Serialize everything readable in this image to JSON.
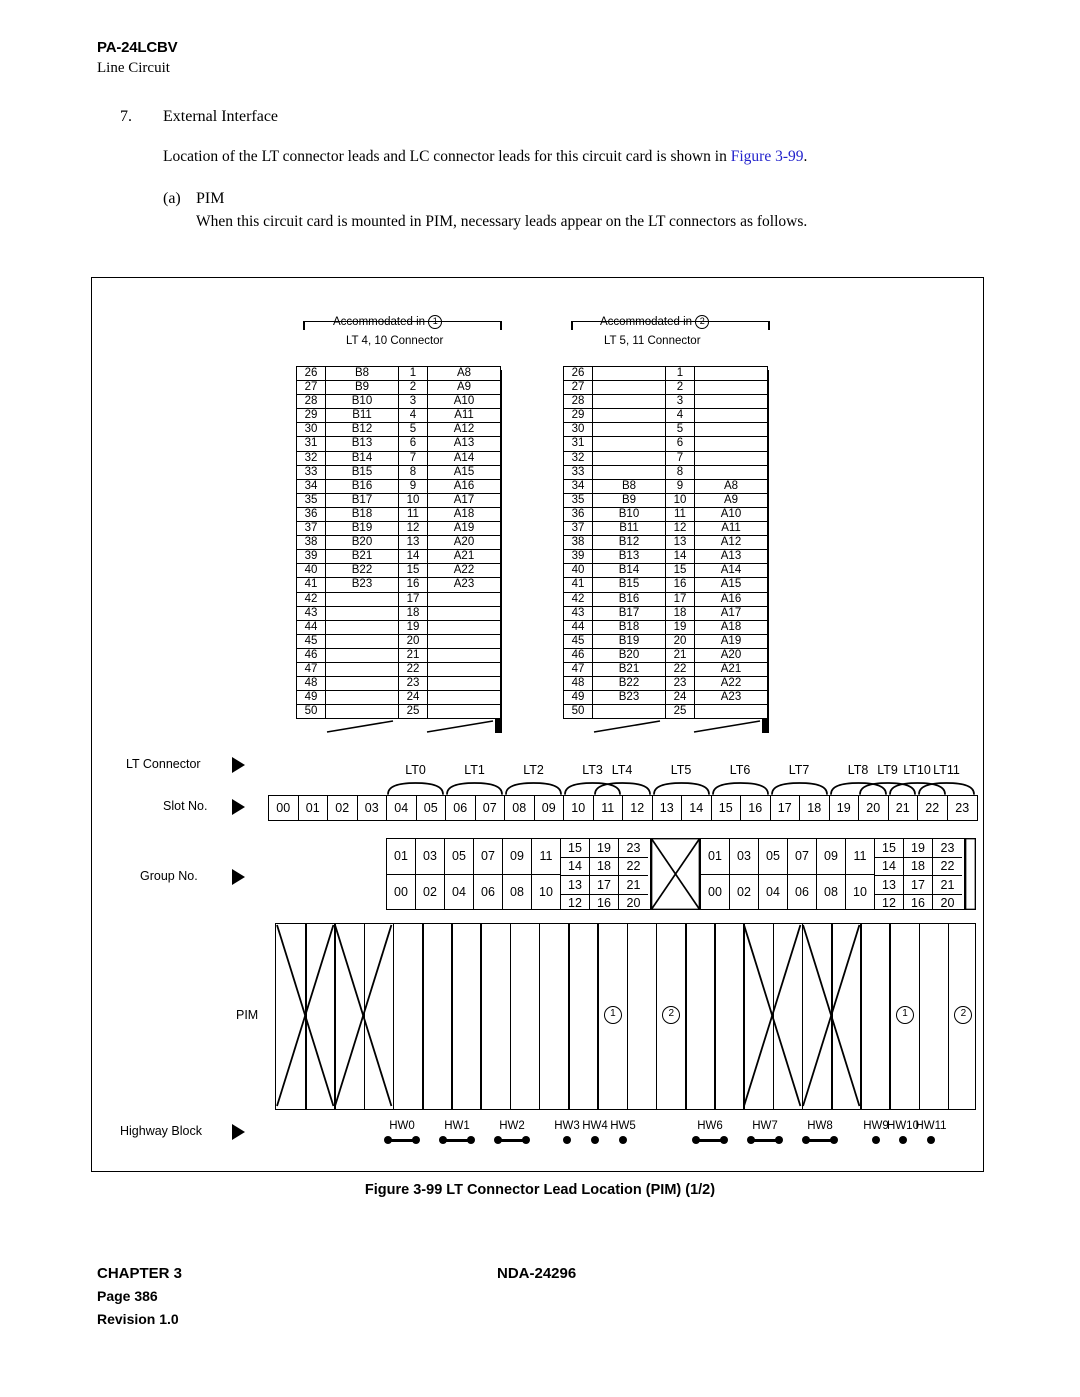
{
  "header": {
    "product": "PA-24LCBV",
    "subtitle": "Line Circuit"
  },
  "section": {
    "number": "7.",
    "title": "External Interface",
    "paragraph": "Location of the LT connector leads and LC connector leads for this circuit card is shown in",
    "link": "Figure 3-99",
    "paragraph_end": ".",
    "sub_label": "(a)",
    "sub_title": "PIM",
    "sub_paragraph": "When this circuit card is mounted in PIM, necessary leads appear on the LT connectors as follows."
  },
  "figure": {
    "caption": "Figure 3-99   LT Connector Lead Location (PIM) (1/2)",
    "connectors": [
      {
        "accommodated_label": "Accommodated in",
        "accommodated_marker": "1",
        "connector_label": "LT 4, 10 Connector",
        "rows": [
          {
            "left_no": "26",
            "left_val": "B8",
            "right_no": "1",
            "right_val": "A8"
          },
          {
            "left_no": "27",
            "left_val": "B9",
            "right_no": "2",
            "right_val": "A9"
          },
          {
            "left_no": "28",
            "left_val": "B10",
            "right_no": "3",
            "right_val": "A10"
          },
          {
            "left_no": "29",
            "left_val": "B11",
            "right_no": "4",
            "right_val": "A11"
          },
          {
            "left_no": "30",
            "left_val": "B12",
            "right_no": "5",
            "right_val": "A12"
          },
          {
            "left_no": "31",
            "left_val": "B13",
            "right_no": "6",
            "right_val": "A13"
          },
          {
            "left_no": "32",
            "left_val": "B14",
            "right_no": "7",
            "right_val": "A14"
          },
          {
            "left_no": "33",
            "left_val": "B15",
            "right_no": "8",
            "right_val": "A15"
          },
          {
            "left_no": "34",
            "left_val": "B16",
            "right_no": "9",
            "right_val": "A16"
          },
          {
            "left_no": "35",
            "left_val": "B17",
            "right_no": "10",
            "right_val": "A17"
          },
          {
            "left_no": "36",
            "left_val": "B18",
            "right_no": "11",
            "right_val": "A18"
          },
          {
            "left_no": "37",
            "left_val": "B19",
            "right_no": "12",
            "right_val": "A19"
          },
          {
            "left_no": "38",
            "left_val": "B20",
            "right_no": "13",
            "right_val": "A20"
          },
          {
            "left_no": "39",
            "left_val": "B21",
            "right_no": "14",
            "right_val": "A21"
          },
          {
            "left_no": "40",
            "left_val": "B22",
            "right_no": "15",
            "right_val": "A22"
          },
          {
            "left_no": "41",
            "left_val": "B23",
            "right_no": "16",
            "right_val": "A23"
          },
          {
            "left_no": "42",
            "left_val": "",
            "right_no": "17",
            "right_val": ""
          },
          {
            "left_no": "43",
            "left_val": "",
            "right_no": "18",
            "right_val": ""
          },
          {
            "left_no": "44",
            "left_val": "",
            "right_no": "19",
            "right_val": ""
          },
          {
            "left_no": "45",
            "left_val": "",
            "right_no": "20",
            "right_val": ""
          },
          {
            "left_no": "46",
            "left_val": "",
            "right_no": "21",
            "right_val": ""
          },
          {
            "left_no": "47",
            "left_val": "",
            "right_no": "22",
            "right_val": ""
          },
          {
            "left_no": "48",
            "left_val": "",
            "right_no": "23",
            "right_val": ""
          },
          {
            "left_no": "49",
            "left_val": "",
            "right_no": "24",
            "right_val": ""
          },
          {
            "left_no": "50",
            "left_val": "",
            "right_no": "25",
            "right_val": ""
          }
        ]
      },
      {
        "accommodated_label": "Accommodated in",
        "accommodated_marker": "2",
        "connector_label": "LT 5, 11 Connector",
        "rows": [
          {
            "left_no": "26",
            "left_val": "",
            "right_no": "1",
            "right_val": ""
          },
          {
            "left_no": "27",
            "left_val": "",
            "right_no": "2",
            "right_val": ""
          },
          {
            "left_no": "28",
            "left_val": "",
            "right_no": "3",
            "right_val": ""
          },
          {
            "left_no": "29",
            "left_val": "",
            "right_no": "4",
            "right_val": ""
          },
          {
            "left_no": "30",
            "left_val": "",
            "right_no": "5",
            "right_val": ""
          },
          {
            "left_no": "31",
            "left_val": "",
            "right_no": "6",
            "right_val": ""
          },
          {
            "left_no": "32",
            "left_val": "",
            "right_no": "7",
            "right_val": ""
          },
          {
            "left_no": "33",
            "left_val": "",
            "right_no": "8",
            "right_val": ""
          },
          {
            "left_no": "34",
            "left_val": "B8",
            "right_no": "9",
            "right_val": "A8"
          },
          {
            "left_no": "35",
            "left_val": "B9",
            "right_no": "10",
            "right_val": "A9"
          },
          {
            "left_no": "36",
            "left_val": "B10",
            "right_no": "11",
            "right_val": "A10"
          },
          {
            "left_no": "37",
            "left_val": "B11",
            "right_no": "12",
            "right_val": "A11"
          },
          {
            "left_no": "38",
            "left_val": "B12",
            "right_no": "13",
            "right_val": "A12"
          },
          {
            "left_no": "39",
            "left_val": "B13",
            "right_no": "14",
            "right_val": "A13"
          },
          {
            "left_no": "40",
            "left_val": "B14",
            "right_no": "15",
            "right_val": "A14"
          },
          {
            "left_no": "41",
            "left_val": "B15",
            "right_no": "16",
            "right_val": "A15"
          },
          {
            "left_no": "42",
            "left_val": "B16",
            "right_no": "17",
            "right_val": "A16"
          },
          {
            "left_no": "43",
            "left_val": "B17",
            "right_no": "18",
            "right_val": "A17"
          },
          {
            "left_no": "44",
            "left_val": "B18",
            "right_no": "19",
            "right_val": "A18"
          },
          {
            "left_no": "45",
            "left_val": "B19",
            "right_no": "20",
            "right_val": "A19"
          },
          {
            "left_no": "46",
            "left_val": "B20",
            "right_no": "21",
            "right_val": "A20"
          },
          {
            "left_no": "47",
            "left_val": "B21",
            "right_no": "22",
            "right_val": "A21"
          },
          {
            "left_no": "48",
            "left_val": "B22",
            "right_no": "23",
            "right_val": "A22"
          },
          {
            "left_no": "49",
            "left_val": "B23",
            "right_no": "24",
            "right_val": "A23"
          },
          {
            "left_no": "50",
            "left_val": "",
            "right_no": "25",
            "right_val": ""
          }
        ]
      }
    ],
    "row_labels": {
      "lt_connector": "LT Connector",
      "slot_no": "Slot No.",
      "group_no": "Group No.",
      "pim": "PIM",
      "highway_block": "Highway Block"
    },
    "lt_labels": [
      "LT0",
      "LT1",
      "LT2",
      "LT3",
      "LT4",
      "LT5",
      "LT6",
      "LT7",
      "LT8",
      "LT9",
      "LT10",
      "LT11"
    ],
    "slot_numbers": [
      "00",
      "01",
      "02",
      "03",
      "04",
      "05",
      "06",
      "07",
      "08",
      "09",
      "10",
      "11",
      "12",
      "13",
      "14",
      "15",
      "16",
      "17",
      "18",
      "19",
      "20",
      "21",
      "22",
      "23"
    ],
    "group_left": {
      "pairs": [
        {
          "top": "01",
          "bottom": "00"
        },
        {
          "top": "03",
          "bottom": "02"
        },
        {
          "top": "05",
          "bottom": "04"
        },
        {
          "top": "07",
          "bottom": "06"
        },
        {
          "top": "09",
          "bottom": "08"
        },
        {
          "top": "11",
          "bottom": "10"
        }
      ],
      "quads": [
        {
          "r1": "15",
          "r2": "14",
          "r3": "13",
          "r4": "12"
        },
        {
          "r1": "19",
          "r2": "18",
          "r3": "17",
          "r4": "16"
        },
        {
          "r1": "23",
          "r2": "22",
          "r3": "21",
          "r4": "20"
        }
      ]
    },
    "group_right": {
      "pairs": [
        {
          "top": "01",
          "bottom": "00"
        },
        {
          "top": "03",
          "bottom": "02"
        },
        {
          "top": "05",
          "bottom": "04"
        },
        {
          "top": "07",
          "bottom": "06"
        },
        {
          "top": "09",
          "bottom": "08"
        },
        {
          "top": "11",
          "bottom": "10"
        }
      ],
      "quads": [
        {
          "r1": "15",
          "r2": "14",
          "r3": "13",
          "r4": "12"
        },
        {
          "r1": "19",
          "r2": "18",
          "r3": "17",
          "r4": "16"
        },
        {
          "r1": "23",
          "r2": "22",
          "r3": "21",
          "r4": "20"
        }
      ]
    },
    "pim_markers": [
      {
        "marker": "1"
      },
      {
        "marker": "2"
      },
      {
        "marker": "1"
      },
      {
        "marker": "2"
      }
    ],
    "highway_blocks": [
      {
        "label": "HW0",
        "paired": true
      },
      {
        "label": "HW1",
        "paired": true
      },
      {
        "label": "HW2",
        "paired": true
      },
      {
        "label": "HW3",
        "paired": false
      },
      {
        "label": "HW4",
        "paired": false
      },
      {
        "label": "HW5",
        "paired": false
      },
      {
        "label": "HW6",
        "paired": true
      },
      {
        "label": "HW7",
        "paired": true
      },
      {
        "label": "HW8",
        "paired": true
      },
      {
        "label": "HW9",
        "paired": false
      },
      {
        "label": "HW10",
        "paired": false
      },
      {
        "label": "HW11",
        "paired": false
      }
    ]
  },
  "footer": {
    "chapter": "CHAPTER 3",
    "page": "Page 386",
    "revision": "Revision 1.0",
    "document": "NDA-24296"
  }
}
